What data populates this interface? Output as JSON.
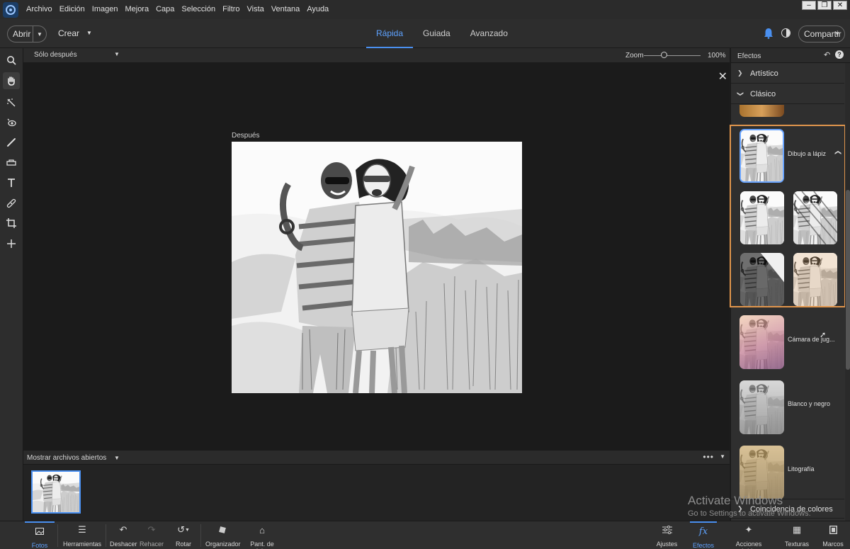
{
  "menu": {
    "items": [
      "Archivo",
      "Edición",
      "Imagen",
      "Mejora",
      "Capa",
      "Selección",
      "Filtro",
      "Vista",
      "Ventana",
      "Ayuda"
    ]
  },
  "toolbar": {
    "open_label": "Abrir",
    "create_label": "Crear",
    "modes": [
      "Rápida",
      "Guiada",
      "Avanzado"
    ],
    "active_mode": "Rápida",
    "share_label": "Compartir"
  },
  "canvas": {
    "view_mode": "Sólo después",
    "zoom_label": "Zoom",
    "zoom_value": "100%",
    "zoom_fraction": 0.35,
    "after_label": "Después"
  },
  "bin": {
    "label": "Mostrar archivos abiertos"
  },
  "effects_panel": {
    "title": "Efectos",
    "categories": [
      {
        "label": "Artístico",
        "expanded": false
      },
      {
        "label": "Clásico",
        "expanded": true
      },
      {
        "label": "Coincidencia de colores",
        "expanded": false
      }
    ],
    "effects": [
      {
        "label": "Dibujo a lápiz",
        "selected": true
      },
      {
        "label": "Cámara de jug..."
      },
      {
        "label": "Blanco y negro"
      },
      {
        "label": "Litografía"
      }
    ]
  },
  "watermark": {
    "line1": "Activate Windows",
    "line2": "Go to Settings to activate Windows."
  },
  "bottom_bar": {
    "left": [
      {
        "label": "Fotos",
        "icon": "photos-icon",
        "active": true
      },
      {
        "label": "Herramientas",
        "icon": "tools-icon"
      },
      {
        "label": "Deshacer",
        "icon": "undo-icon"
      },
      {
        "label": "Rehacer",
        "icon": "redo-icon"
      },
      {
        "label": "Rotar",
        "icon": "rotate-icon"
      },
      {
        "label": "Organizador",
        "icon": "organizer-icon"
      },
      {
        "label": "Pant. de inic.",
        "icon": "home-icon"
      }
    ],
    "right": [
      {
        "label": "Ajustes",
        "icon": "adjustments-icon"
      },
      {
        "label": "Efectos",
        "icon": "fx-icon",
        "active": true
      },
      {
        "label": "Acciones rápidas",
        "icon": "quick-actions-icon"
      },
      {
        "label": "Texturas",
        "icon": "textures-icon"
      },
      {
        "label": "Marcos",
        "icon": "frames-icon"
      }
    ]
  },
  "colors": {
    "accent": "#4a90f0",
    "selection_outline": "#e0954c",
    "app_bg": "#1e1e1e"
  }
}
